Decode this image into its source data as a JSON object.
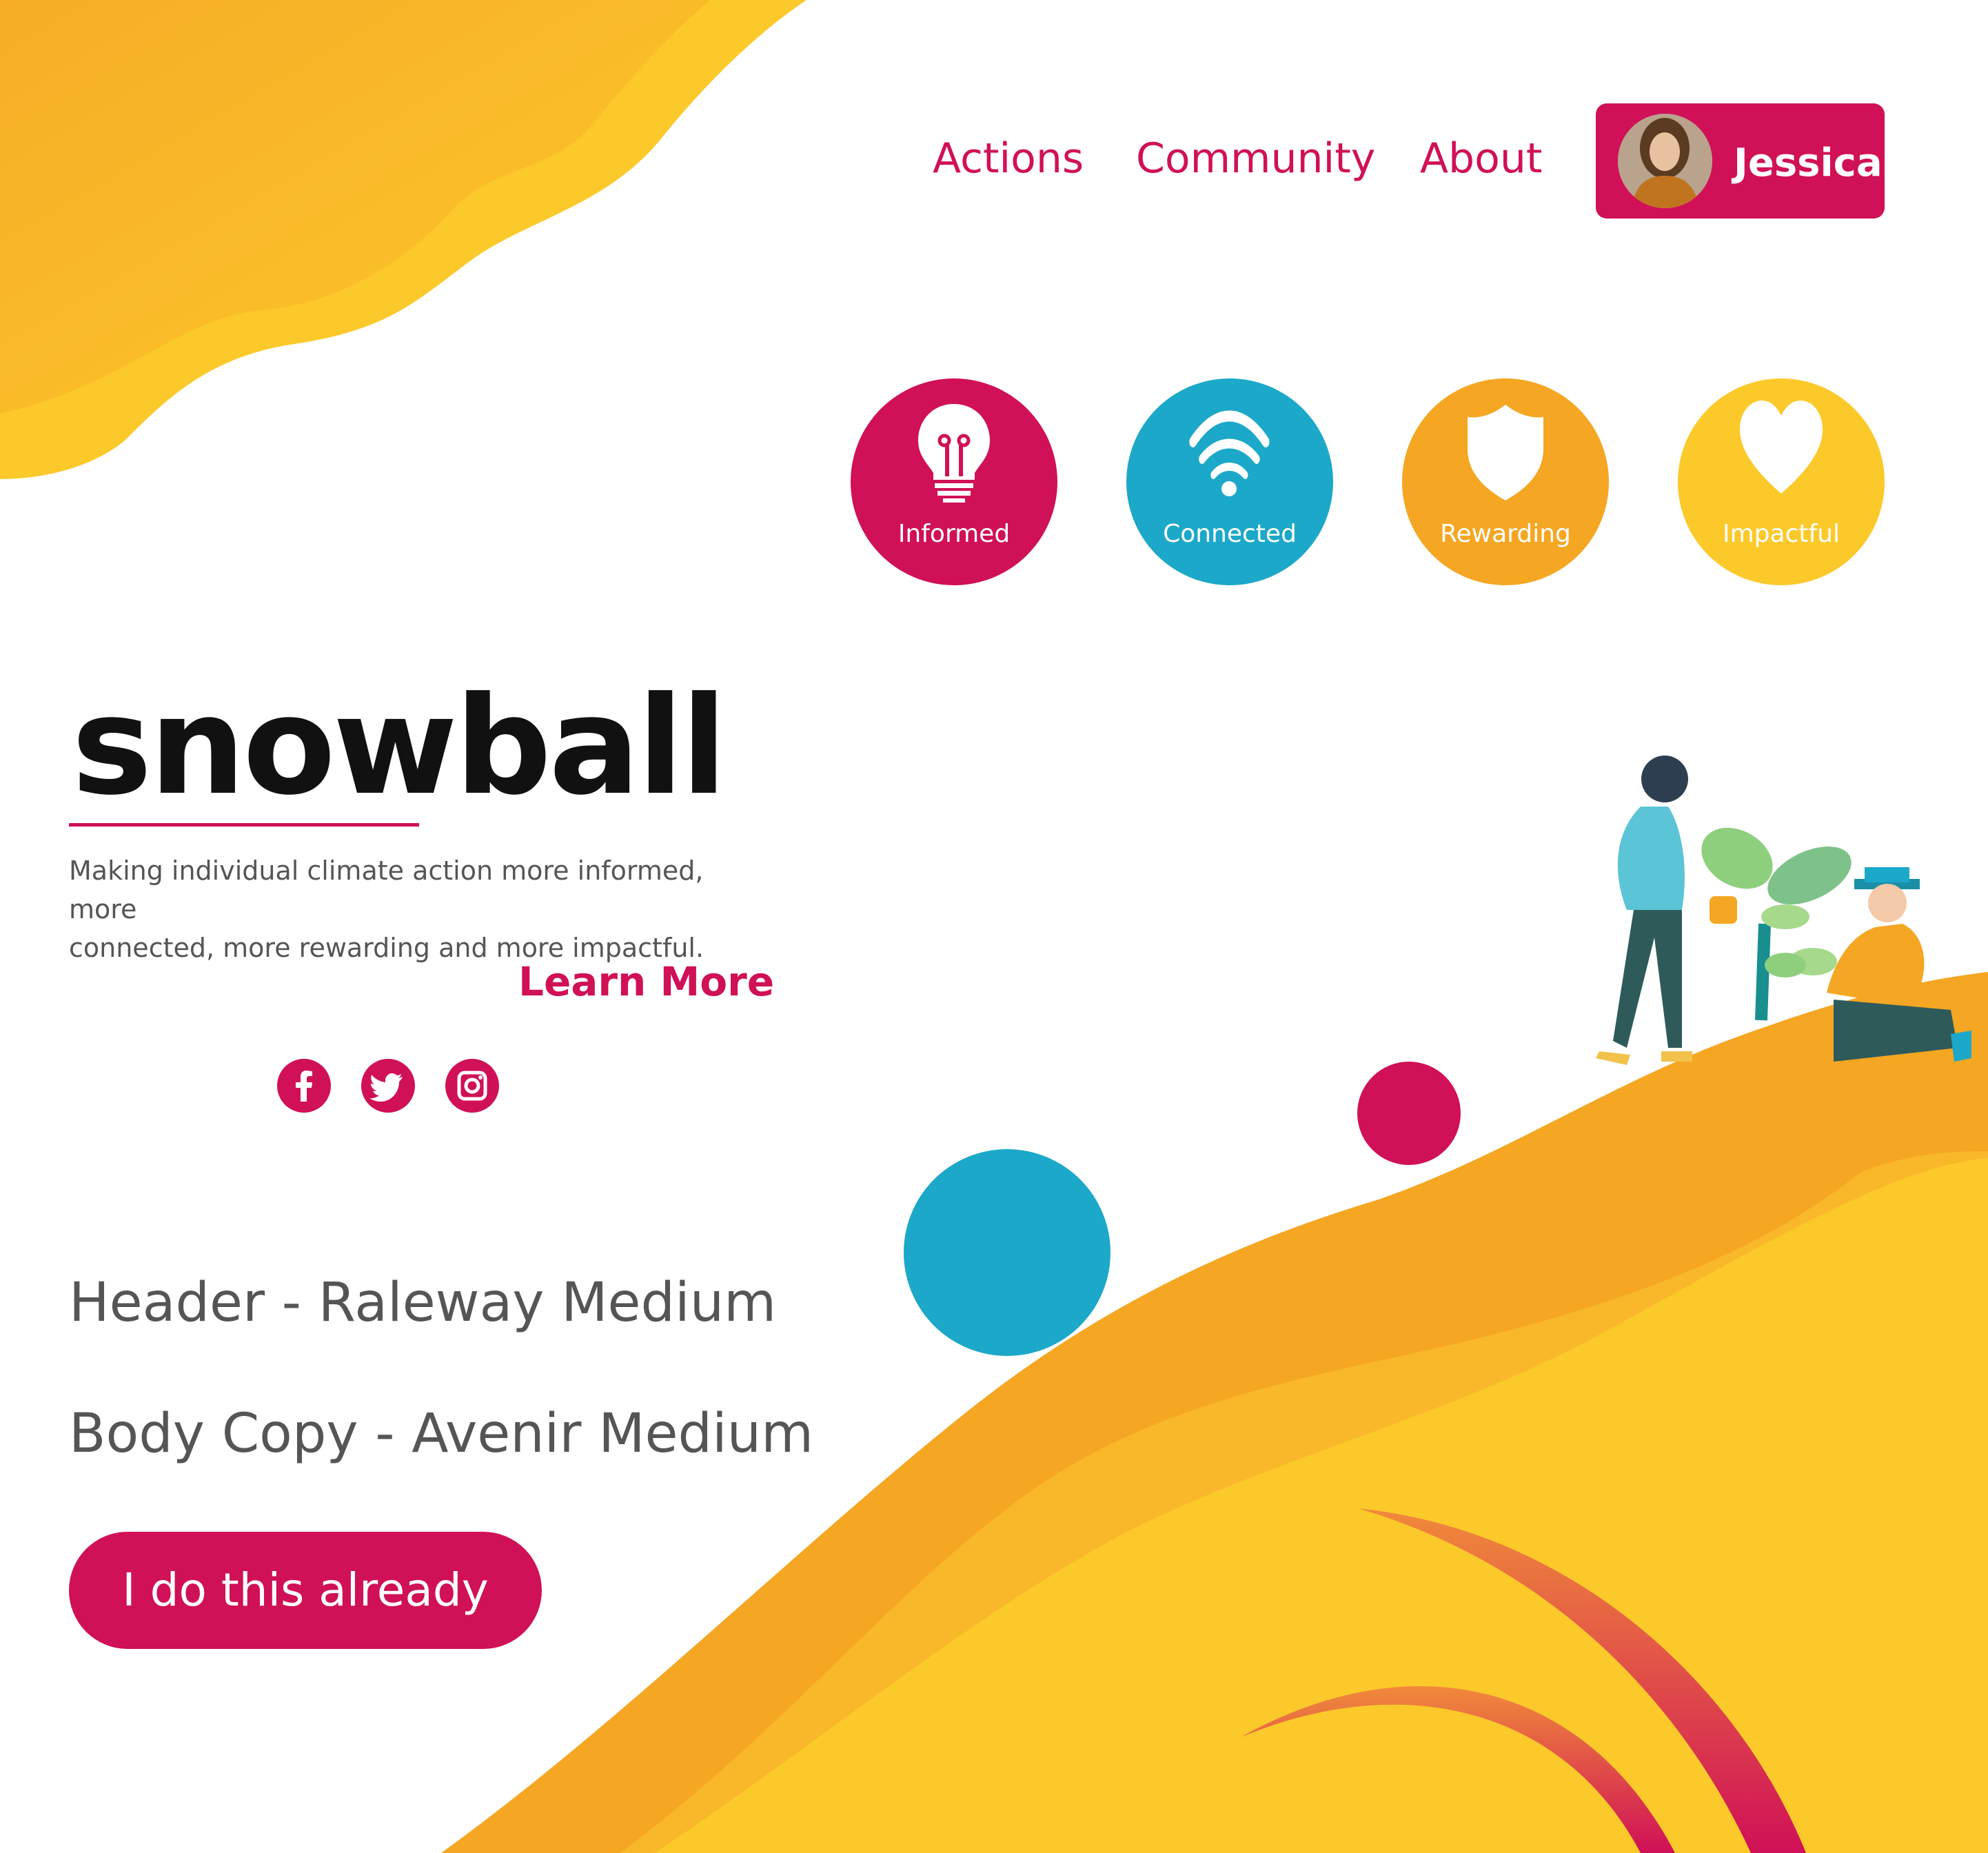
{
  "nav": {
    "links": [
      {
        "label": "Actions"
      },
      {
        "label": "Community"
      },
      {
        "label": "About"
      }
    ],
    "user": {
      "name": "Jessica"
    }
  },
  "features": [
    {
      "label": "Informed",
      "icon": "lightbulb-icon",
      "color": "#d01057"
    },
    {
      "label": "Connected",
      "icon": "wifi-icon",
      "color": "#1ca8c9"
    },
    {
      "label": "Rewarding",
      "icon": "shield-icon",
      "color": "#f5a623"
    },
    {
      "label": "Impactful",
      "icon": "heart-icon",
      "color": "#fcc92b"
    }
  ],
  "hero": {
    "logo": "snowball",
    "tagline_line1": "Making individual climate action more informed, more",
    "tagline_line2": "connected, more rewarding and more impactful.",
    "learn_more": "Learn More"
  },
  "social": [
    {
      "icon": "facebook-icon"
    },
    {
      "icon": "twitter-icon"
    },
    {
      "icon": "instagram-icon"
    }
  ],
  "specs": {
    "header_font": "Header - Raleway Medium",
    "body_font": "Body Copy - Avenir Medium"
  },
  "cta": {
    "label": "I do this already"
  },
  "colors": {
    "brand": "#d01057",
    "blue": "#1ca8c9",
    "orange": "#f5a623",
    "yellow": "#fcc92b",
    "text_gray": "#555555"
  }
}
